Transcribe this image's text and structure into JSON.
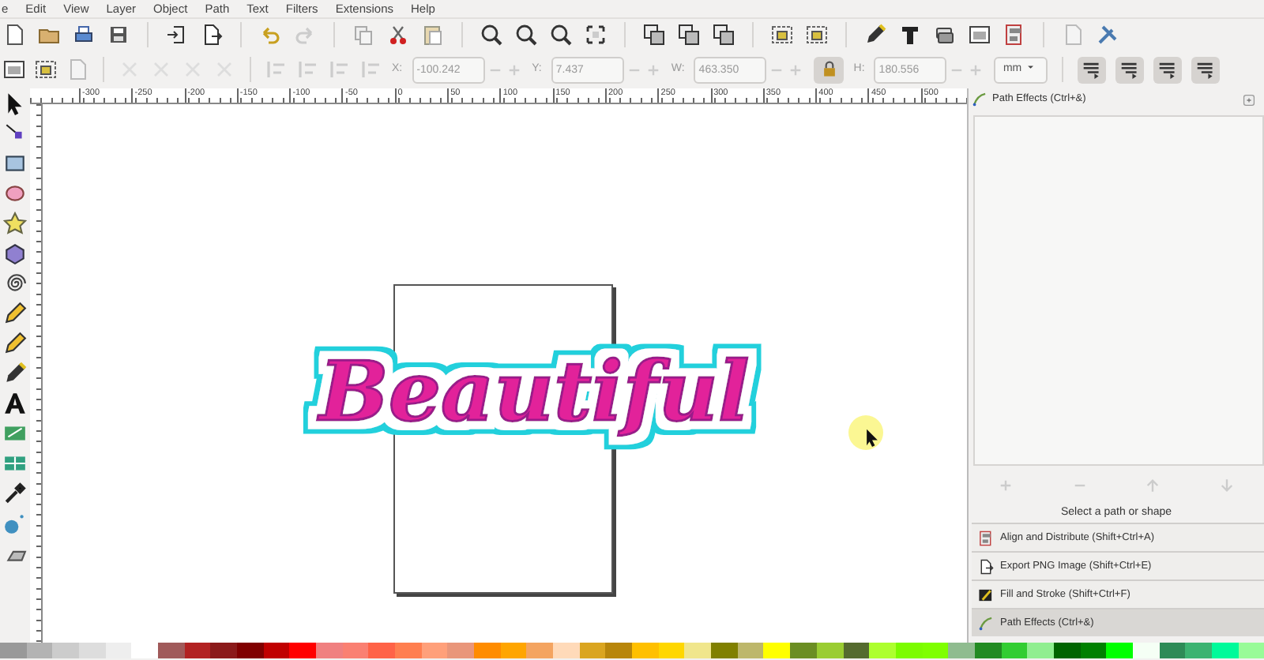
{
  "menu_bar": [
    "e",
    "Edit",
    "View",
    "Layer",
    "Object",
    "Path",
    "Text",
    "Filters",
    "Extensions",
    "Help"
  ],
  "transform_toolbar": {
    "fields": [
      {
        "label": "X:",
        "value": "-100.242"
      },
      {
        "label": "Y:",
        "value": "7.437"
      },
      {
        "label": "W:",
        "value": "463.350"
      }
    ],
    "lock": {
      "on": true
    },
    "height_field": {
      "label": "H:",
      "value": "180.556"
    },
    "unit": "mm"
  },
  "ruler": {
    "labels": [
      "-300",
      "-250",
      "-200",
      "-150",
      "-100",
      "-50",
      "0",
      "50",
      "100",
      "150",
      "200",
      "250",
      "300",
      "350",
      "400",
      "450",
      "500"
    ]
  },
  "canvas": {
    "artwork_text": "Beautiful"
  },
  "panel": {
    "title": "Path Effects (Ctrl+&)",
    "status": "Select a path or shape",
    "dialogs": [
      {
        "kind": "align",
        "label": "Align and Distribute (Shift+Ctrl+A)",
        "selected": false
      },
      {
        "kind": "export",
        "label": "Export PNG Image (Shift+Ctrl+E)",
        "selected": false
      },
      {
        "kind": "fill",
        "label": "Fill and Stroke (Shift+Ctrl+F)",
        "selected": false
      },
      {
        "kind": "effects",
        "label": "Path Effects (Ctrl+&)",
        "selected": true
      }
    ]
  },
  "palette": [
    {
      "color": "#999999"
    },
    {
      "color": "#b3b3b3"
    },
    {
      "color": "#cccccc"
    },
    {
      "color": "#dddddd"
    },
    {
      "color": "#eeeeee"
    },
    {
      "color": "#ffffff"
    },
    {
      "color": "#a05a5a"
    },
    {
      "color": "#b22222"
    },
    {
      "color": "#8b1a1a"
    },
    {
      "color": "#800000"
    },
    {
      "color": "#c00000"
    },
    {
      "color": "#ff0000"
    },
    {
      "color": "#f08080"
    },
    {
      "color": "#fa8072"
    },
    {
      "color": "#ff6347"
    },
    {
      "color": "#ff7f50"
    },
    {
      "color": "#ffa07a"
    },
    {
      "color": "#e9967a"
    },
    {
      "color": "#ff8c00"
    },
    {
      "color": "#ffa500"
    },
    {
      "color": "#f4a460"
    },
    {
      "color": "#ffdab9"
    },
    {
      "color": "#daa520"
    },
    {
      "color": "#b8860b"
    },
    {
      "color": "#ffc000"
    },
    {
      "color": "#ffd700"
    },
    {
      "color": "#f0e68c"
    },
    {
      "color": "#808000"
    },
    {
      "color": "#bdb76b"
    },
    {
      "color": "#ffff00"
    },
    {
      "color": "#6b8e23"
    },
    {
      "color": "#9acd32"
    },
    {
      "color": "#556b2f"
    },
    {
      "color": "#adff2f"
    },
    {
      "color": "#7cfc00"
    },
    {
      "color": "#7fff00"
    },
    {
      "color": "#8fbc8f"
    },
    {
      "color": "#228b22"
    },
    {
      "color": "#32cd32"
    },
    {
      "color": "#90ee90"
    },
    {
      "color": "#006400"
    },
    {
      "color": "#008000"
    },
    {
      "color": "#00ff00"
    },
    {
      "color": "#f5fff5"
    },
    {
      "color": "#2e8b57"
    },
    {
      "color": "#3cb371"
    },
    {
      "color": "#00fa9a"
    },
    {
      "color": "#98fb98"
    }
  ]
}
